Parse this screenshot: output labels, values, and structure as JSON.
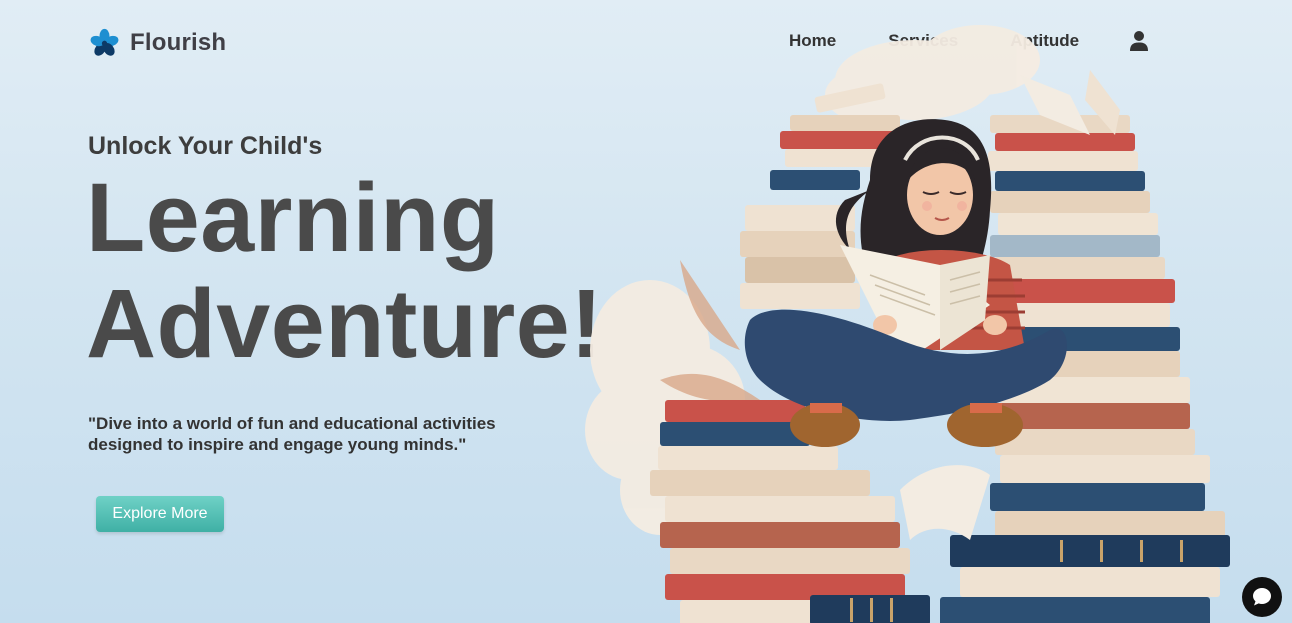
{
  "brand": {
    "name": "Flourish",
    "logo_icon": "flower-icon",
    "logo_colors": [
      "#1e8fd1",
      "#0d3a66"
    ]
  },
  "nav": {
    "items": [
      {
        "label": "Home"
      },
      {
        "label": "Services"
      },
      {
        "label": "Aptitude"
      }
    ],
    "user_icon": "user-icon"
  },
  "hero": {
    "subheading": "Unlock Your Child's",
    "title_line1": "Learning",
    "title_line2": "Adventure!",
    "tagline": "\"Dive into a world of fun and educational activities designed to inspire and engage young minds.\"",
    "cta_label": "Explore More",
    "illustration": "girl-reading-on-book-stack-illustration"
  },
  "chat": {
    "icon": "chat-bubble-icon"
  },
  "colors": {
    "accent": "#4fc0b4",
    "text_dark": "#4a4a4a",
    "background": "#d3e5f1"
  }
}
